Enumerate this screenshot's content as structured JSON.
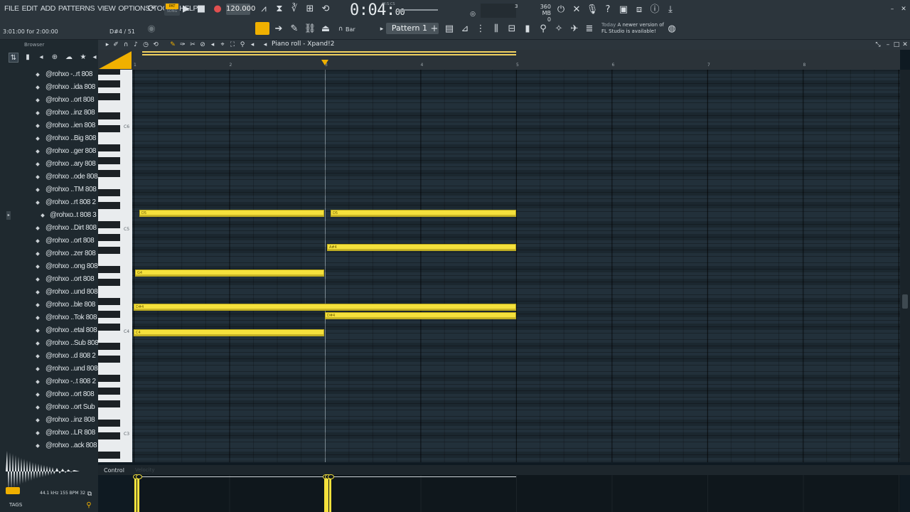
{
  "menu": [
    "FILE",
    "EDIT",
    "ADD",
    "PATTERNS",
    "VIEW",
    "OPTIONS",
    "TOOLS",
    "HELP"
  ],
  "transport": {
    "pat_label": "PAT",
    "song_label": "SONG",
    "tempo": "120.000",
    "time_main": "0:04:",
    "time_small": "00",
    "time_unit": "M:S:CS",
    "memory_mb": "360 MB",
    "memory_line2": "0",
    "cpu_value": "3"
  },
  "hint": {
    "position": "3:01:00 for 2:00:00",
    "note": "D#4 / 51"
  },
  "toolbar": {
    "snap": "Bar",
    "pattern": "Pattern 1"
  },
  "news": {
    "today": "Today",
    "line1": "A newer version of",
    "line2": "FL Studio is available!"
  },
  "browser": {
    "title": "Browser",
    "items": [
      "@rohxo -..rt 808",
      "@rohxo ..ida 808",
      "@rohxo ..ort 808",
      "@rohxo ..inz 808",
      "@rohxo ..ien 808",
      "@rohxo ..Big 808",
      "@rohxo ..ger 808",
      "@rohxo ..ary 808",
      "@rohxo ..ode 808",
      "@rohxo ..TM 808",
      "@rohxo ..rt 808 2",
      "@rohxo..t 808 3",
      "@rohxo ..Dirt 808",
      "@rohxo ..ort 808",
      "@rohxo ..zer 808",
      "@rohxo ..ong 808",
      "@rohxo ..ort 808",
      "@rohxo ..und 808",
      "@rohxo ..ble 808",
      "@rohxo ..Tok 808",
      "@rohxo ..etal 808",
      "@rohxo ..Sub 808",
      "@rohxo ..d 808 2",
      "@rohxo ..und 808",
      "@rohxo -..t 808 2",
      "@rohxo ..ort 808",
      "@rohxo ..ort Sub",
      "@rohxo ..inz 808",
      "@rohxo ..LR 808",
      "@rohxo ..ack 808"
    ],
    "selected_index": 11,
    "wave_info": "44.1 kHz 155 BPM 32",
    "tags": "TAGS"
  },
  "piano_roll": {
    "title": "Piano roll - Xpand!2",
    "bar_numbers": [
      "1",
      "2",
      "3",
      "4",
      "5",
      "6",
      "7",
      "8"
    ],
    "key_labels": [
      "C6",
      "C5",
      "C4",
      "C3"
    ],
    "notes": [
      {
        "label": "D5",
        "pitch": "D5"
      },
      {
        "label": "D5",
        "pitch": "D5"
      },
      {
        "label": "A#4",
        "pitch": "A#4"
      },
      {
        "label": "G4",
        "pitch": "G4"
      },
      {
        "label": "D#4",
        "pitch": "D#4"
      },
      {
        "label": "D#4",
        "pitch": "D#4"
      },
      {
        "label": "D4",
        "pitch": "D4"
      },
      {
        "label": "C4",
        "pitch": "C4"
      }
    ]
  },
  "control": {
    "label": "Control",
    "sub": "Velocity"
  },
  "colors": {
    "accent": "#f0b000",
    "note": "#f5e13c",
    "grid_bg": "#22303a"
  }
}
